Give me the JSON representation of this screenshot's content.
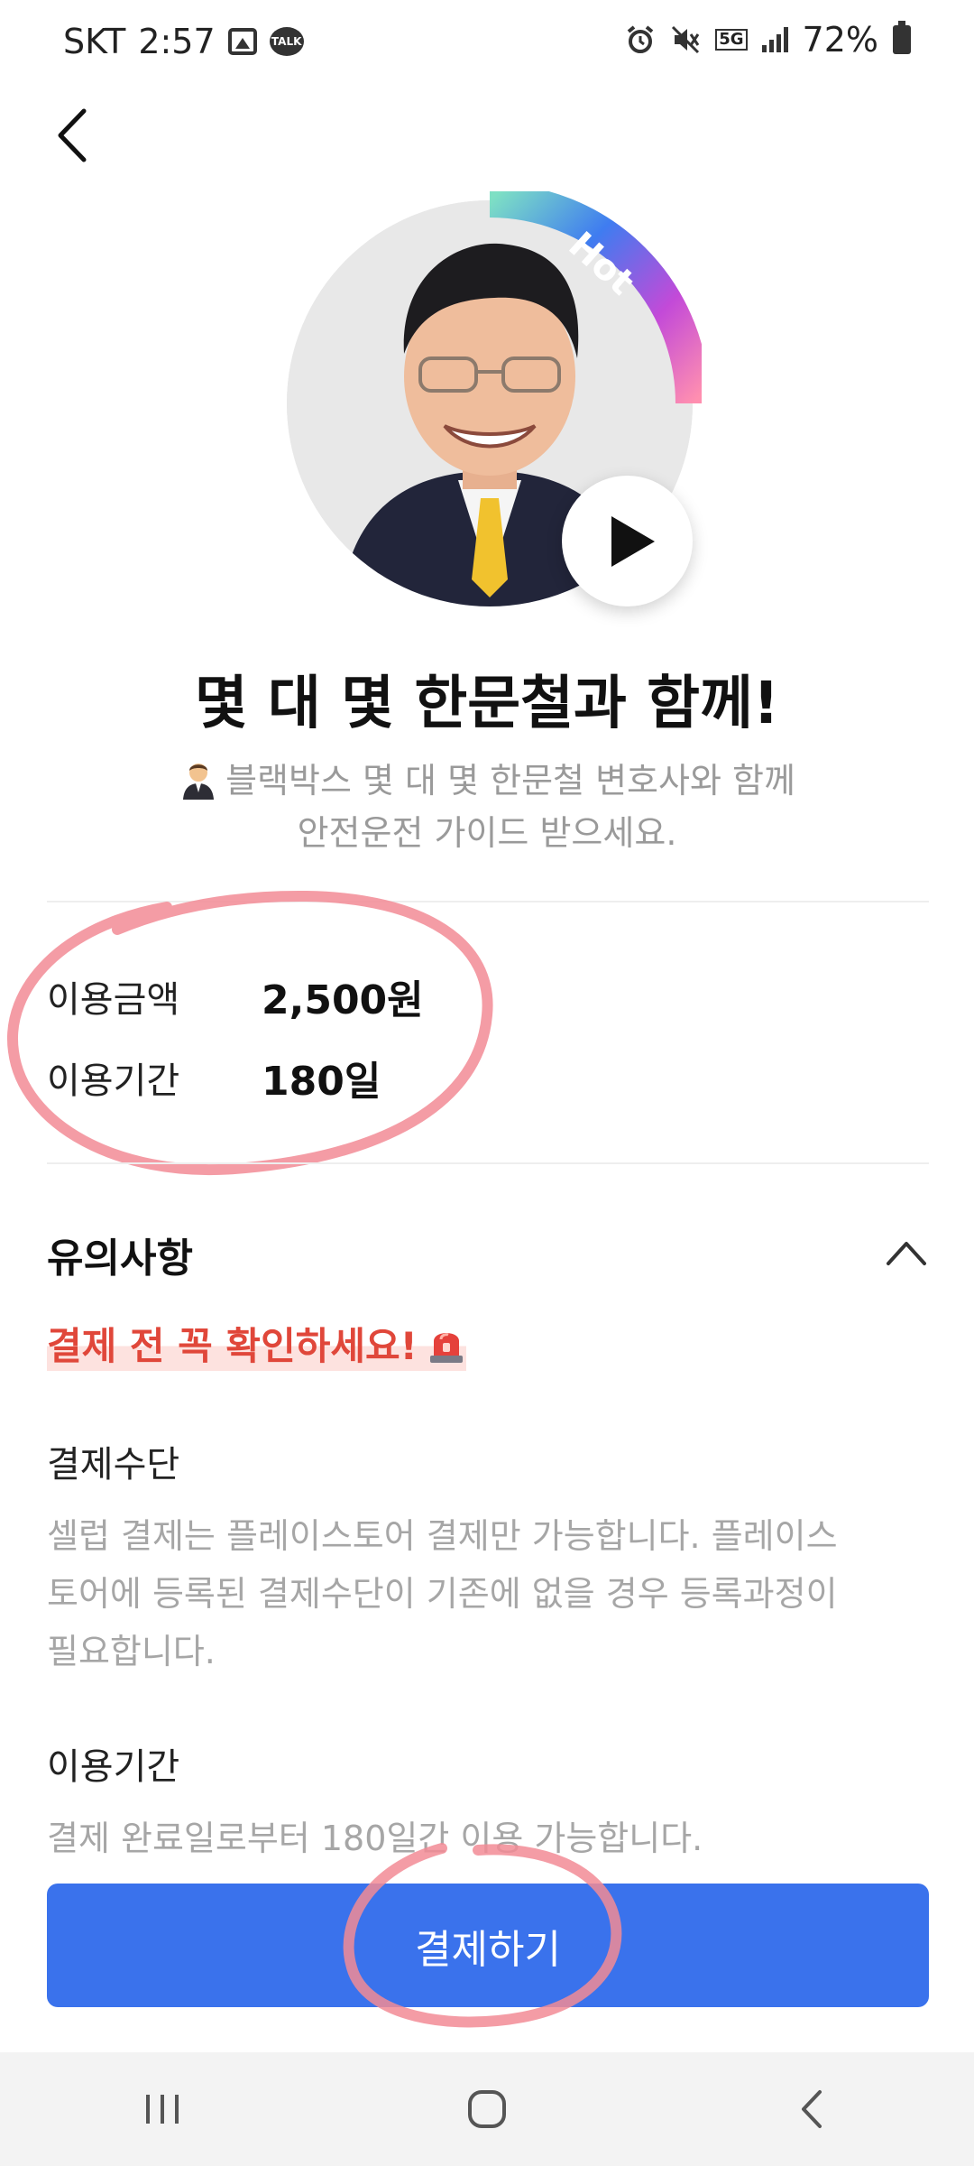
{
  "status_bar": {
    "carrier": "SKT",
    "time": "2:57",
    "network": "5G",
    "battery": "72%",
    "icons": [
      "image-icon",
      "talk-icon",
      "alarm-icon",
      "mute-icon",
      "signal-icon",
      "battery-icon"
    ],
    "talk_label": "TALK"
  },
  "header": {
    "back_icon": "back-arrow-icon"
  },
  "profile": {
    "badge": "Hot",
    "play_icon": "play-icon"
  },
  "title": "몇 대 몇 한문철과 함께!",
  "subtitle": {
    "line1": "블랙박스 몇 대 몇 한문철 변호사와 함께",
    "line2": "안전운전 가이드 받으세요."
  },
  "info": {
    "price_label": "이용금액",
    "price_value": "2,500원",
    "period_label": "이용기간",
    "period_value": "180일"
  },
  "notice": {
    "heading": "유의사항",
    "warning": "결제 전 꼭 확인하세요!",
    "sections": [
      {
        "title": "결제수단",
        "body_lines": [
          "셀럽 결제는 플레이스토어 결제만 가능합니다. 플레이스",
          "토어에 등록된 결제수단이 기존에 없을 경우 등록과정이",
          "필요합니다."
        ]
      },
      {
        "title": "이용기간",
        "body_lines": [
          "결제 완료일로부터 180일간 이용 가능합니다."
        ]
      }
    ]
  },
  "pay_button": "결제하기",
  "colors": {
    "accent": "#3a72ec",
    "warning": "#e0473a",
    "annotation": "#f28b95"
  }
}
